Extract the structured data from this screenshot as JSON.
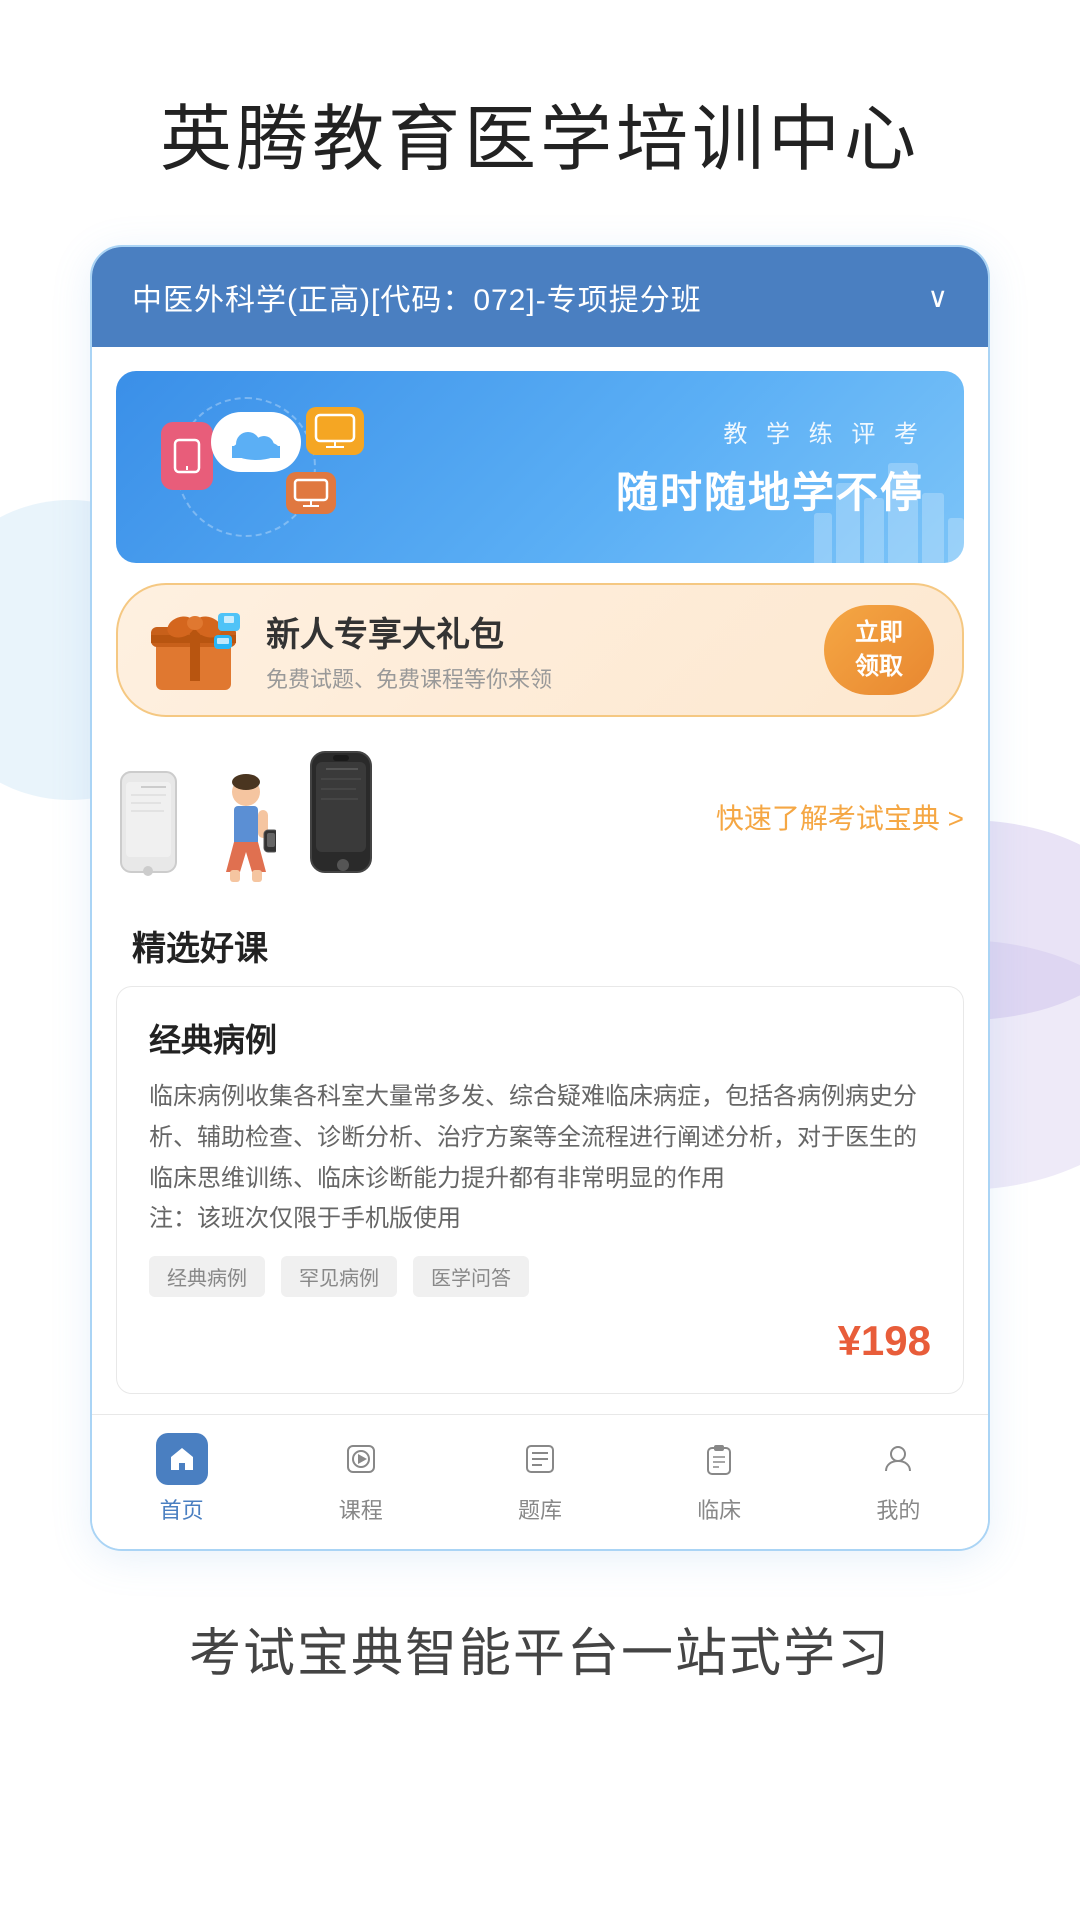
{
  "app": {
    "top_title": "英腾教育医学培训中心",
    "bottom_tagline": "考试宝典智能平台一站式学习"
  },
  "course_header": {
    "text": "中医外科学(正高)[代码：072]-专项提分班",
    "chevron": "∨"
  },
  "main_banner": {
    "subtitle": "教 学 练 评 考",
    "title": "随时随地学不停"
  },
  "gift_banner": {
    "title": "新人专享大礼包",
    "subtitle": "免费试题、免费课程等你来领",
    "btn_line1": "立即",
    "btn_line2": "领取"
  },
  "exam_guide": {
    "link_text": "快速了解考试宝典 >"
  },
  "featured_courses": {
    "title": "精选好课",
    "course": {
      "name": "经典病例",
      "description": "临床病例收集各科室大量常多发、综合疑难临床病症，包括各病例病史分析、辅助检查、诊断分析、治疗方案等全流程进行阐述分析，对于医生的临床思维训练、临床诊断能力提升都有非常明显的作用\n注：该班次仅限于手机版使用",
      "tags": [
        "经典病例",
        "罕见病例",
        "医学问答"
      ],
      "price": "¥198"
    }
  },
  "bottom_nav": {
    "items": [
      {
        "label": "首页",
        "icon": "home",
        "active": true
      },
      {
        "label": "课程",
        "icon": "play",
        "active": false
      },
      {
        "label": "题库",
        "icon": "list",
        "active": false
      },
      {
        "label": "临床",
        "icon": "clipboard",
        "active": false
      },
      {
        "label": "我的",
        "icon": "user",
        "active": false
      }
    ]
  },
  "colors": {
    "primary": "#4a7fc1",
    "accent": "#f5a744",
    "price": "#e85d3a"
  }
}
